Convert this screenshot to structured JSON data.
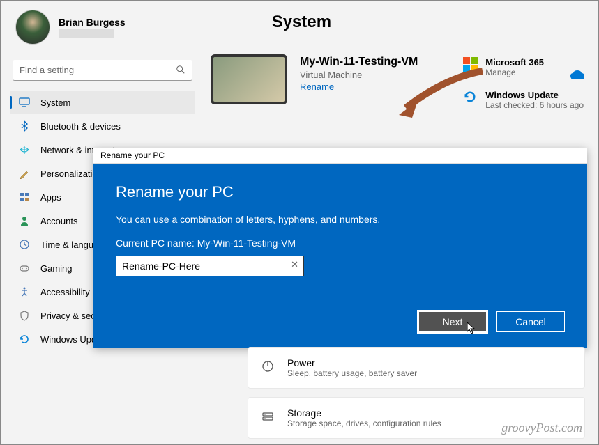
{
  "user": {
    "name": "Brian Burgess"
  },
  "page_title": "System",
  "search": {
    "placeholder": "Find a setting"
  },
  "nav": [
    {
      "label": "System",
      "icon": "system",
      "active": true
    },
    {
      "label": "Bluetooth & devices",
      "icon": "bluetooth"
    },
    {
      "label": "Network & internet",
      "icon": "network"
    },
    {
      "label": "Personalization",
      "icon": "personalization"
    },
    {
      "label": "Apps",
      "icon": "apps"
    },
    {
      "label": "Accounts",
      "icon": "accounts"
    },
    {
      "label": "Time & language",
      "icon": "time"
    },
    {
      "label": "Gaming",
      "icon": "gaming"
    },
    {
      "label": "Accessibility",
      "icon": "accessibility"
    },
    {
      "label": "Privacy & security",
      "icon": "privacy"
    },
    {
      "label": "Windows Update",
      "icon": "update"
    }
  ],
  "device": {
    "name": "My-Win-11-Testing-VM",
    "type": "Virtual Machine",
    "rename_link": "Rename"
  },
  "tiles": {
    "ms365": {
      "title": "Microsoft 365",
      "sub": "Manage"
    },
    "update": {
      "title": "Windows Update",
      "sub": "Last checked: 6 hours ago"
    }
  },
  "dialog": {
    "titlebar": "Rename your PC",
    "title": "Rename your PC",
    "desc": "You can use a combination of letters, hyphens, and numbers.",
    "current_label": "Current PC name: ",
    "current_name": "My-Win-11-Testing-VM",
    "input_value": "Rename-PC-Here",
    "next": "Next",
    "cancel": "Cancel"
  },
  "cards": {
    "power": {
      "title": "Power",
      "sub": "Sleep, battery usage, battery saver"
    },
    "storage": {
      "title": "Storage",
      "sub": "Storage space, drives, configuration rules"
    }
  },
  "watermark": "groovyPost.com"
}
